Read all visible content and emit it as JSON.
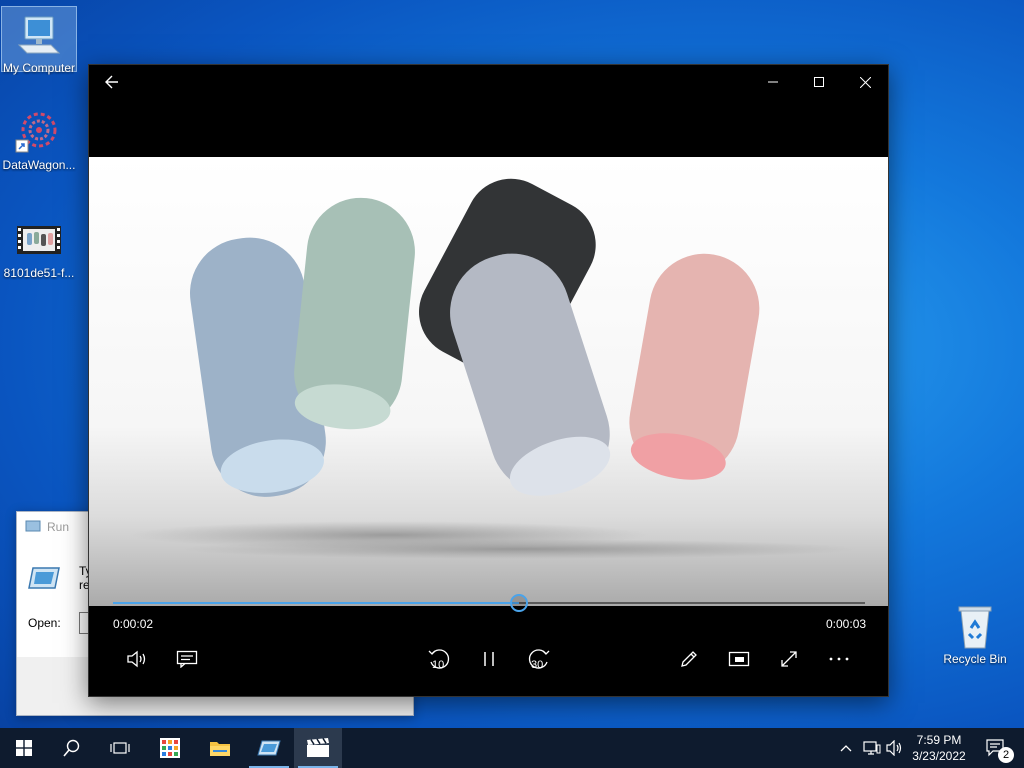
{
  "desktop": {
    "icons": [
      {
        "label": "My Computer",
        "icon": "computer-icon"
      },
      {
        "label": "DataWagon...",
        "icon": "datawagon-shortcut-icon"
      },
      {
        "label": "8101de51-f...",
        "icon": "video-file-icon"
      },
      {
        "label": "Recycle Bin",
        "icon": "recycle-bin-icon"
      }
    ]
  },
  "run_dialog": {
    "title": "Run",
    "text_partial": "Ty\nre",
    "open_label": "Open:"
  },
  "player": {
    "back_icon": "back-arrow-icon",
    "window_controls": [
      "minimize-icon",
      "maximize-icon",
      "close-icon"
    ],
    "current_time": "0:00:02",
    "total_time": "0:00:03",
    "progress": 0.54,
    "skip_back_label": "10",
    "skip_forward_label": "30",
    "controls_left": [
      "volume-icon",
      "subtitles-icon"
    ],
    "controls_center": [
      "skip-back-10-icon",
      "pause-icon",
      "skip-forward-30-icon"
    ],
    "controls_right": [
      "pen-edit-icon",
      "mini-view-icon",
      "fullscreen-icon",
      "more-options-icon"
    ],
    "accent_color": "#4aa3ea"
  },
  "taskbar": {
    "items": [
      "start-icon",
      "search-icon",
      "task-view-icon",
      "store-apps-icon",
      "file-explorer-icon",
      "run-icon",
      "movies-tv-icon"
    ],
    "clock_time": "7:59 PM",
    "clock_date": "3/23/2022",
    "notification_count": "2"
  }
}
